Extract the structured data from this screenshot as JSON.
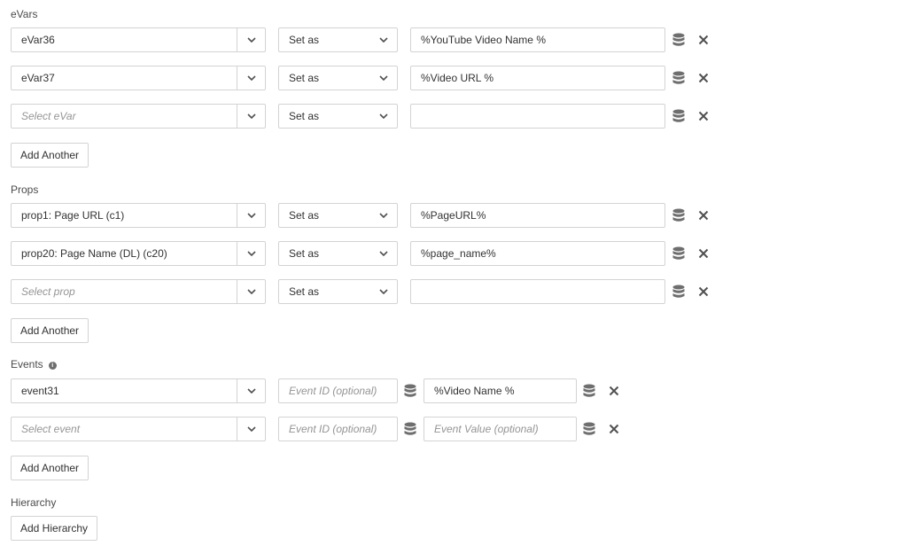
{
  "evars": {
    "label": "eVars",
    "rows": [
      {
        "variable": "eVar36",
        "mode": "Set as",
        "value": "%YouTube Video Name %"
      },
      {
        "variable": "eVar37",
        "mode": "Set as",
        "value": "%Video URL %"
      },
      {
        "variable_placeholder": "Select eVar",
        "mode": "Set as",
        "value": ""
      }
    ],
    "add_label": "Add Another"
  },
  "props": {
    "label": "Props",
    "rows": [
      {
        "variable": "prop1: Page URL (c1)",
        "mode": "Set as",
        "value": "%PageURL%"
      },
      {
        "variable": "prop20: Page Name (DL) (c20)",
        "mode": "Set as",
        "value": "%page_name%"
      },
      {
        "variable_placeholder": "Select prop",
        "mode": "Set as",
        "value": ""
      }
    ],
    "add_label": "Add Another"
  },
  "events": {
    "label": "Events",
    "info_glyph": "i",
    "rows": [
      {
        "event": "event31",
        "id_placeholder": "Event ID (optional)",
        "value": "%Video Name %"
      },
      {
        "event_placeholder": "Select event",
        "id_placeholder": "Event ID (optional)",
        "value_placeholder": "Event Value (optional)"
      }
    ],
    "add_label": "Add Another"
  },
  "hierarchy": {
    "label": "Hierarchy",
    "add_label": "Add Hierarchy"
  },
  "icons": {
    "chevron": "chevron-down-icon",
    "data_element": "database-icon",
    "remove": "close-icon"
  },
  "colors": {
    "border": "#d3d3d3",
    "icon": "#6e6e6e",
    "text": "#323232",
    "placeholder": "#959595"
  }
}
